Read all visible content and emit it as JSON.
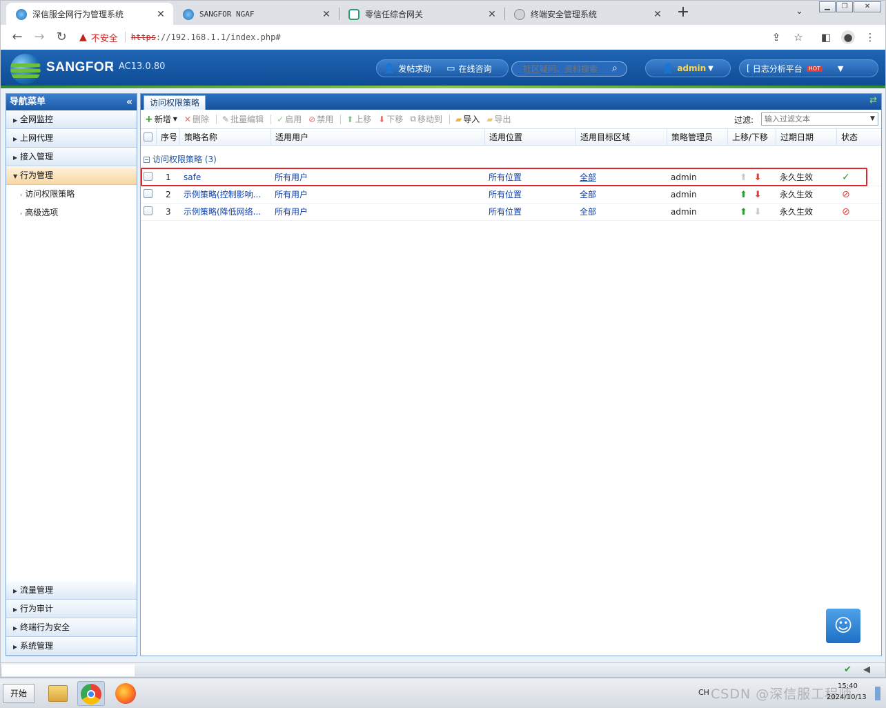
{
  "browser": {
    "tabs": [
      {
        "label": "深信服全网行为管理系统",
        "active": true
      },
      {
        "label": "SANGFOR NGAF",
        "active": false
      },
      {
        "label": "零信任综合网关",
        "active": false
      },
      {
        "label": "终端安全管理系统",
        "active": false
      }
    ],
    "security_label": "不安全",
    "url_scheme": "https",
    "url_rest": "://192.168.1.1/index.php#"
  },
  "header": {
    "brand": "SANGFOR",
    "version": "AC13.0.80",
    "help_link": "发帖求助",
    "online_consult": "在线咨询",
    "search_placeholder": "社区疑问、资料搜索",
    "user": "admin",
    "log_platform": "日志分析平台",
    "hot_badge": "HOT"
  },
  "sidebar": {
    "title": "导航菜单",
    "top_groups": [
      "全网监控",
      "上网代理",
      "接入管理"
    ],
    "open_group": "行为管理",
    "open_items": [
      "访问权限策略",
      "高级选项"
    ],
    "bottom_groups": [
      "流量管理",
      "行为审计",
      "终端行为安全",
      "系统管理"
    ]
  },
  "content": {
    "tab_label": "访问权限策略",
    "actions": {
      "add": "新增",
      "delete": "删除",
      "batch_edit": "批量编辑",
      "enable": "启用",
      "disable": "禁用",
      "move_up": "上移",
      "move_down": "下移",
      "move_to": "移动到",
      "import": "导入",
      "export": "导出"
    },
    "filter_label": "过滤:",
    "filter_placeholder": "输入过滤文本",
    "columns": [
      "序号",
      "策略名称",
      "适用用户",
      "适用位置",
      "适用目标区域",
      "策略管理员",
      "上移/下移",
      "过期日期",
      "状态"
    ],
    "group_label": "访问权限策略 (3)",
    "rows": [
      {
        "index": "1",
        "name": "safe",
        "users": "所有用户",
        "location": "所有位置",
        "target": "全部",
        "admin": "admin",
        "expiry": "永久生效",
        "status": "enabled"
      },
      {
        "index": "2",
        "name": "示例策略(控制影响...",
        "users": "所有用户",
        "location": "所有位置",
        "target": "全部",
        "admin": "admin",
        "expiry": "永久生效",
        "status": "disabled"
      },
      {
        "index": "3",
        "name": "示例策略(降低网络...",
        "users": "所有用户",
        "location": "所有位置",
        "target": "全部",
        "admin": "admin",
        "expiry": "永久生效",
        "status": "disabled"
      }
    ]
  },
  "taskbar": {
    "start": "开始",
    "lang": "CH",
    "time": "15:40",
    "date": "2024/10/13"
  },
  "watermark": "CSDN @深信服工程师",
  "colors": {
    "header_blue": "#1f66b5",
    "highlight_red": "#e0262b",
    "link_blue": "#0d3fa8"
  }
}
